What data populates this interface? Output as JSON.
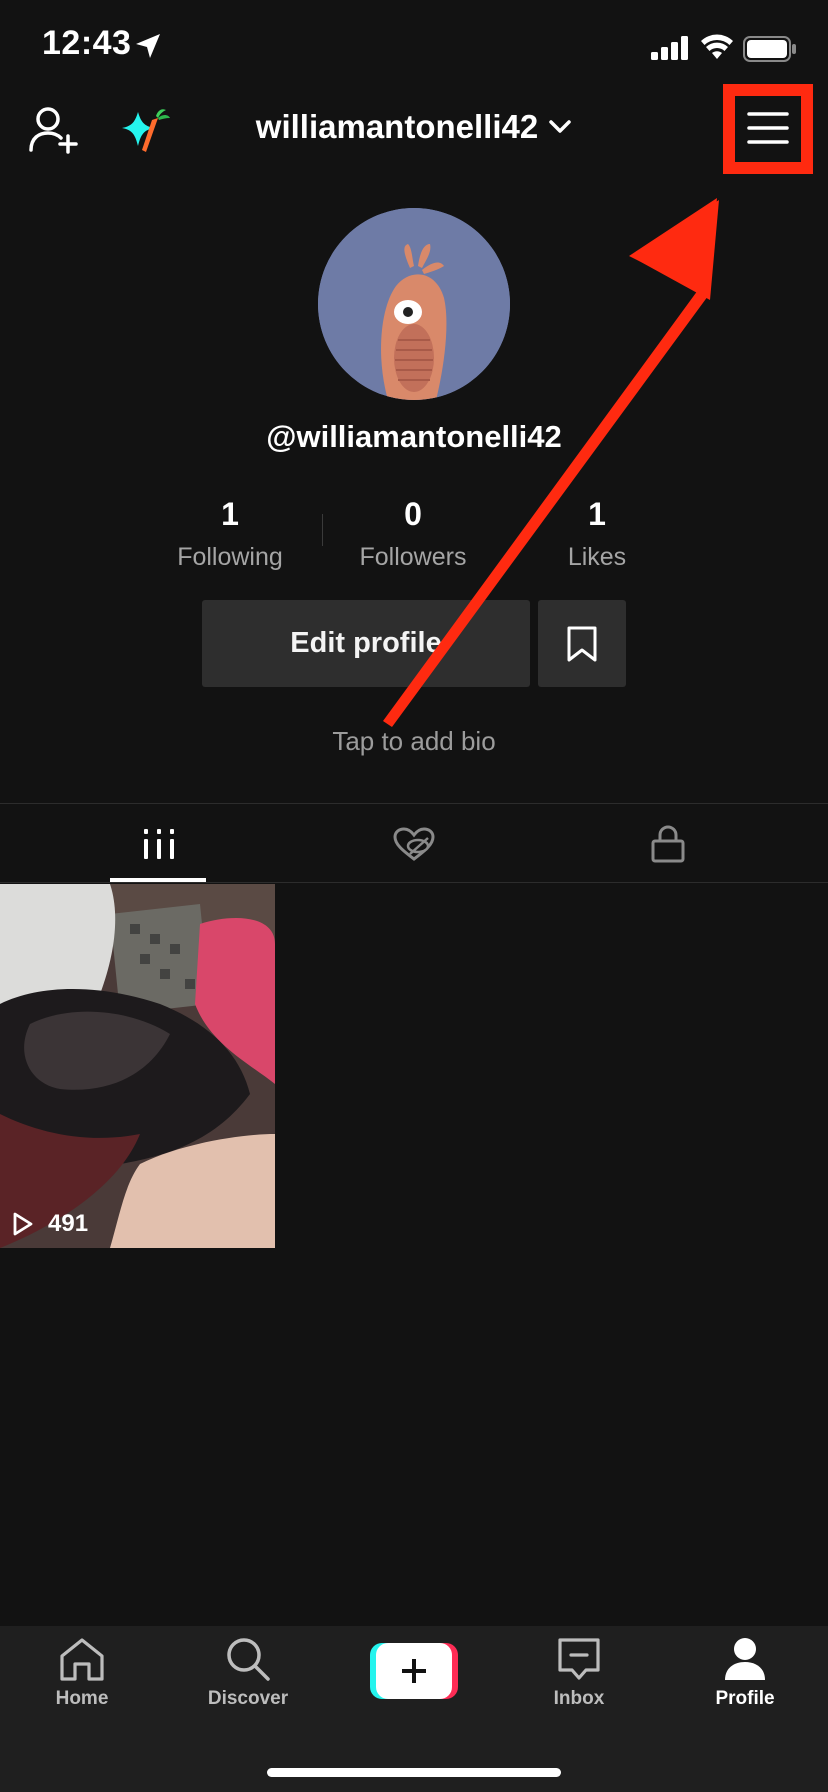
{
  "status_bar": {
    "time": "12:43"
  },
  "header": {
    "username": "williamantonelli42",
    "add_user_icon": "add-user-icon",
    "sparkle_icon": "carrot-sparkle-icon",
    "menu_icon": "hamburger-menu-icon"
  },
  "profile": {
    "handle": "@williamantonelli42",
    "stats": {
      "following": {
        "value": "1",
        "label": "Following"
      },
      "followers": {
        "value": "0",
        "label": "Followers"
      },
      "likes": {
        "value": "1",
        "label": "Likes"
      }
    },
    "edit_button_label": "Edit profile",
    "bio_placeholder": "Tap to add bio"
  },
  "tabs": [
    {
      "icon": "grid-icon",
      "active": true
    },
    {
      "icon": "liked-hidden-icon",
      "active": false
    },
    {
      "icon": "lock-icon",
      "active": false
    }
  ],
  "videos": [
    {
      "views": "491"
    }
  ],
  "bottom_nav": {
    "home": "Home",
    "discover": "Discover",
    "inbox": "Inbox",
    "profile": "Profile",
    "active": "Profile"
  },
  "annotation": {
    "highlight_color": "#ff2a10"
  },
  "colors": {
    "background": "#121212",
    "button_bg": "#2e2e2e",
    "create_left": "#25f4ee",
    "create_right": "#fe2c55"
  }
}
